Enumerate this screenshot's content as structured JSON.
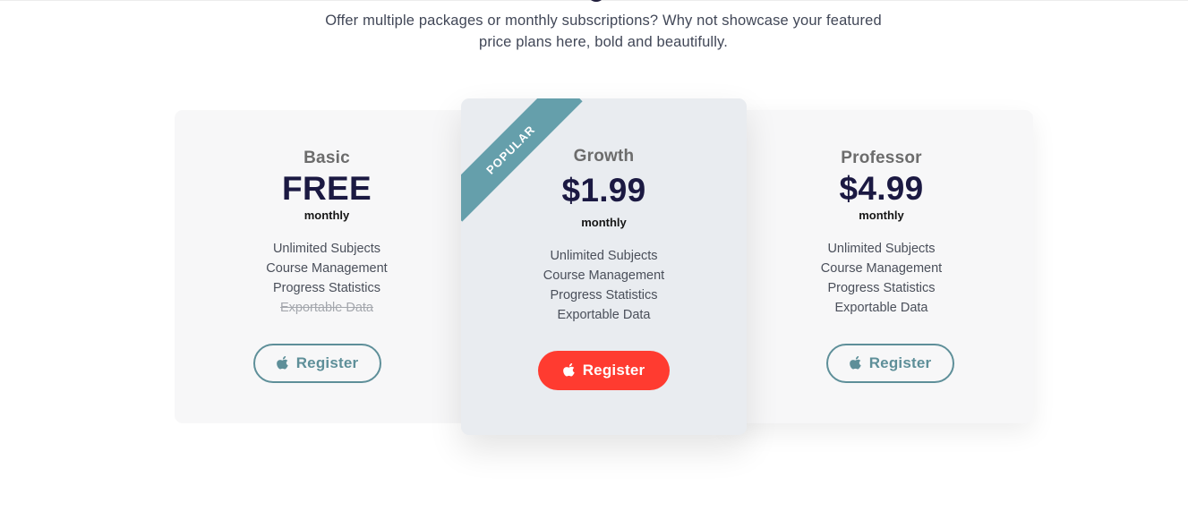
{
  "intro": {
    "line1": "Offer multiple packages or monthly subscriptions? Why not showcase your featured",
    "line2": "price plans here, bold and beautifully."
  },
  "plans": [
    {
      "name": "Basic",
      "price": "FREE",
      "period": "monthly",
      "features": [
        {
          "label": "Unlimited Subjects",
          "included": true
        },
        {
          "label": "Course Management",
          "included": true
        },
        {
          "label": "Progress Statistics",
          "included": true
        },
        {
          "label": "Exportable Data",
          "included": false
        }
      ],
      "button": {
        "label": "Register",
        "icon": "apple-icon",
        "style": "outline"
      }
    },
    {
      "name": "Growth",
      "badge": "POPULAR",
      "price": "$1.99",
      "period": "monthly",
      "features": [
        {
          "label": "Unlimited Subjects",
          "included": true
        },
        {
          "label": "Course Management",
          "included": true
        },
        {
          "label": "Progress Statistics",
          "included": true
        },
        {
          "label": "Exportable Data",
          "included": true
        }
      ],
      "button": {
        "label": "Register",
        "icon": "apple-icon",
        "style": "filled"
      }
    },
    {
      "name": "Professor",
      "price": "$4.99",
      "period": "monthly",
      "features": [
        {
          "label": "Unlimited Subjects",
          "included": true
        },
        {
          "label": "Course Management",
          "included": true
        },
        {
          "label": "Progress Statistics",
          "included": true
        },
        {
          "label": "Exportable Data",
          "included": true
        }
      ],
      "button": {
        "label": "Register",
        "icon": "apple-icon",
        "style": "outline"
      }
    }
  ],
  "colors": {
    "accent_teal": "#5e8f99",
    "badge_teal": "#659fab",
    "cta_red": "#ff3b30",
    "price_navy": "#1b1942",
    "card_background": "#f7f7f8",
    "featured_card_background": "#e9ecf0"
  }
}
